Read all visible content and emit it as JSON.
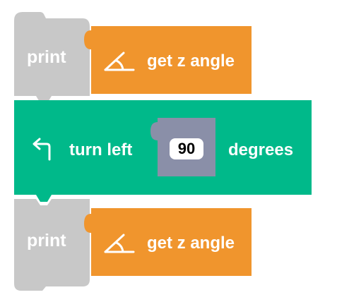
{
  "blocks": [
    {
      "type": "print",
      "label": "print",
      "color": "#c8c8c8",
      "reporter": {
        "icon": "angle-icon",
        "label": "get z angle",
        "color": "#f0952d"
      }
    },
    {
      "type": "turn",
      "icon": "turn-left-arrow-icon",
      "label": "turn left",
      "color": "#00b98a",
      "input_value": "90",
      "input_slot_color": "#8a8fa8",
      "suffix": "degrees"
    },
    {
      "type": "print",
      "label": "print",
      "color": "#c8c8c8",
      "reporter": {
        "icon": "angle-icon",
        "label": "get z angle",
        "color": "#f0952d"
      }
    }
  ]
}
